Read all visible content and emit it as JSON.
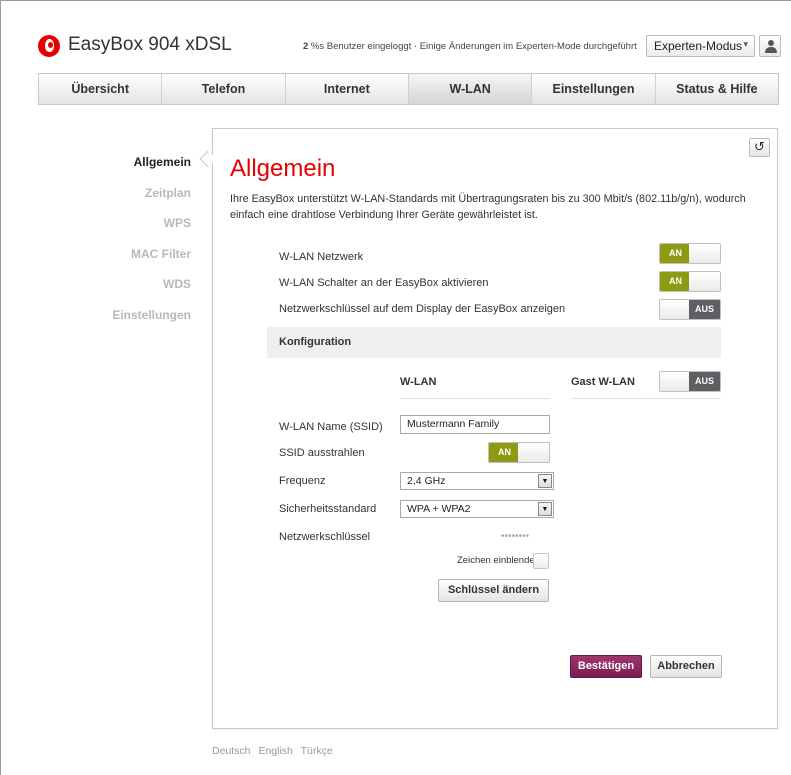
{
  "header": {
    "app_title": "EasyBox 904 xDSL",
    "users_count": "2",
    "status_text": " %s Benutzer eingeloggt · Einige Änderungen im Experten-Mode durchgeführt",
    "mode_select_value": "Experten-Modus",
    "mode_caret": "▾",
    "reset_glyph": "↺"
  },
  "tabs": [
    {
      "label": "Übersicht"
    },
    {
      "label": "Telefon"
    },
    {
      "label": "Internet"
    },
    {
      "label": "W-LAN"
    },
    {
      "label": "Einstellungen"
    },
    {
      "label": "Status & Hilfe"
    }
  ],
  "sidenav": [
    {
      "label": "Allgemein"
    },
    {
      "label": "Zeitplan"
    },
    {
      "label": "WPS"
    },
    {
      "label": "MAC Filter"
    },
    {
      "label": "WDS"
    },
    {
      "label": "Einstellungen"
    }
  ],
  "page": {
    "title": "Allgemein",
    "intro": "Ihre EasyBox unterstützt W-LAN-Standards mit Übertragungsraten bis zu 300 Mbit/s (802.11b/g/n), wodurch einfach eine drahtlose Verbindung Ihrer Geräte gewährleistet ist."
  },
  "settings": {
    "wlan_network": {
      "label": "W-LAN Netzwerk",
      "state": "AN"
    },
    "wlan_switch": {
      "label": "W-LAN Schalter an der EasyBox aktivieren",
      "state": "AN"
    },
    "show_key": {
      "label": "Netzwerkschlüssel auf dem Display der EasyBox anzeigen",
      "state": "AUS"
    }
  },
  "config": {
    "section_title": "Konfiguration",
    "col_wlan": "W-LAN",
    "col_guest": "Gast W-LAN",
    "guest_state": "AUS",
    "ssid_label": "W-LAN Name (SSID)",
    "ssid_value": "Mustermann Family",
    "broadcast_label": "SSID ausstrahlen",
    "broadcast_state": "AN",
    "freq_label": "Frequenz",
    "freq_value": "2,4 GHz",
    "security_label": "Sicherheitsstandard",
    "security_value": "WPA + WPA2",
    "key_label": "Netzwerkschlüssel",
    "key_mask": "••••••••",
    "reveal_label": "Zeichen einblenden",
    "change_key_label": "Schlüssel ändern",
    "select_arrow": "▼"
  },
  "actions": {
    "confirm": "Bestätigen",
    "cancel": "Abbrechen"
  },
  "footer": {
    "languages": [
      "Deutsch",
      "English",
      "Türkçe"
    ]
  },
  "colors": {
    "brand_red": "#e60000",
    "toggle_on": "#8c9a14",
    "toggle_off": "#5d5f63",
    "primary_button": "#8a2760"
  }
}
